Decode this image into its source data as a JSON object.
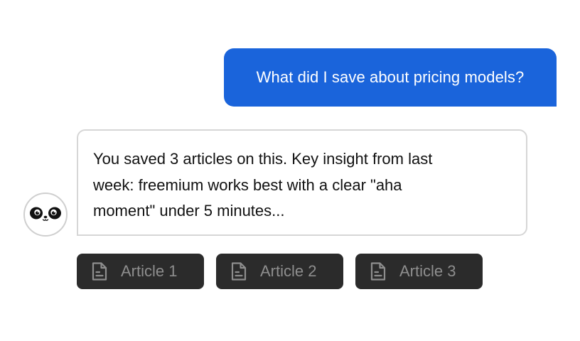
{
  "conversation": {
    "user_message": "What did I save about pricing models?",
    "assistant_message": "You saved 3 articles on this. Key insight from last\nweek: freemium works best with a clear \"aha\nmoment\" under 5 minutes...",
    "assistant_avatar_icon": "panda-face-icon"
  },
  "sources": [
    {
      "label": "Article 1",
      "icon": "document-icon"
    },
    {
      "label": "Article 2",
      "icon": "document-icon"
    },
    {
      "label": "Article 3",
      "icon": "document-icon"
    }
  ],
  "colors": {
    "user_bubble": "#1a64db",
    "assistant_border": "#d6d6d6",
    "chip_background": "#2b2b2b",
    "chip_text": "#8e8e8e"
  }
}
